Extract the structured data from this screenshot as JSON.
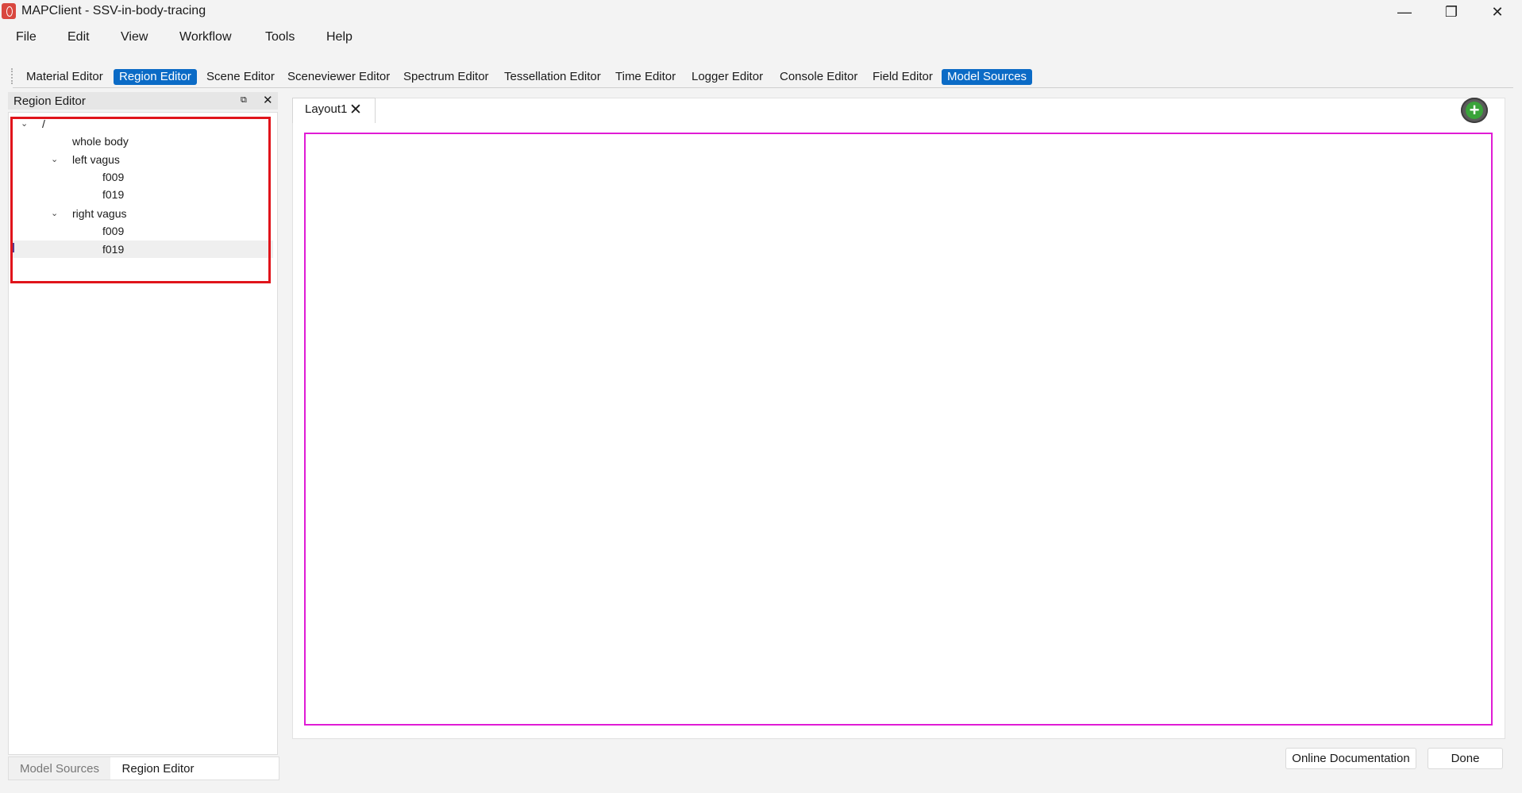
{
  "window": {
    "title": "MAPClient - SSV-in-body-tracing",
    "minimize_glyph": "—",
    "restore_glyph": "❐",
    "close_glyph": "✕"
  },
  "menu": [
    "File",
    "Edit",
    "View",
    "Workflow",
    "Tools",
    "Help"
  ],
  "toolbar": {
    "items": [
      {
        "label": "Material Editor",
        "active": false
      },
      {
        "label": "Region Editor",
        "active": true
      },
      {
        "label": "Scene Editor",
        "active": false
      },
      {
        "label": "Sceneviewer Editor",
        "active": false
      },
      {
        "label": "Spectrum Editor",
        "active": false
      },
      {
        "label": "Tessellation Editor",
        "active": false
      },
      {
        "label": "Time Editor",
        "active": false
      },
      {
        "label": "Logger Editor",
        "active": false
      },
      {
        "label": "Console Editor",
        "active": false
      },
      {
        "label": "Field Editor",
        "active": false
      },
      {
        "label": "Model Sources",
        "active": true
      }
    ],
    "accent_color": "#0b6bc6"
  },
  "dock": {
    "title": "Region Editor",
    "float_glyph": "⧉",
    "close_glyph": "✕",
    "tree": {
      "root": "/",
      "whole_body": "whole body",
      "left_vagus": "left vagus",
      "left_children": [
        "f009",
        "f019"
      ],
      "right_vagus": "right vagus",
      "right_children": [
        "f009",
        "f019"
      ],
      "expanded_glyph": "⌄"
    },
    "bottom_tabs": [
      "Model Sources",
      "Region Editor"
    ]
  },
  "main": {
    "layout_tab": "Layout1",
    "layout_tab_close": "✕",
    "add_glyph": "+",
    "canvas_border_color": "#e01cd5",
    "highlight_color": "#e0141b"
  },
  "footer": {
    "online_docs": "Online Documentation",
    "done": "Done"
  }
}
